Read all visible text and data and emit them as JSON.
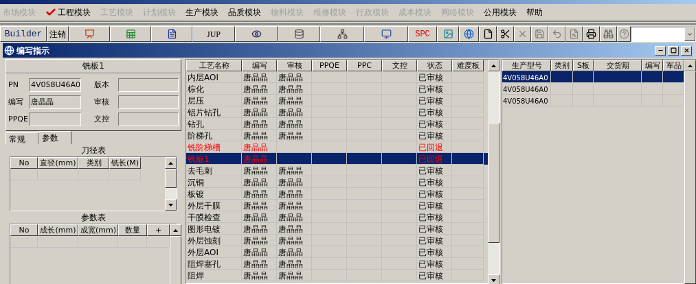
{
  "menu": [
    {
      "label": "市场模块",
      "enabled": false,
      "checked": false
    },
    {
      "label": "工程模块",
      "enabled": true,
      "checked": true
    },
    {
      "label": "工艺模块",
      "enabled": false,
      "checked": false
    },
    {
      "label": "计划模块",
      "enabled": false,
      "checked": false
    },
    {
      "label": "生产模块",
      "enabled": true,
      "checked": false
    },
    {
      "label": "品质模块",
      "enabled": true,
      "checked": false
    },
    {
      "label": "物料模块",
      "enabled": false,
      "checked": false
    },
    {
      "label": "维修模块",
      "enabled": false,
      "checked": false
    },
    {
      "label": "行政模块",
      "enabled": false,
      "checked": false
    },
    {
      "label": "成本模块",
      "enabled": false,
      "checked": false
    },
    {
      "label": "网络模块",
      "enabled": false,
      "checked": false
    },
    {
      "label": "公用模块",
      "enabled": true,
      "checked": false
    },
    {
      "label": "帮助",
      "enabled": true,
      "checked": false
    }
  ],
  "toolbar": {
    "builder": "Builder",
    "logout": "注销",
    "jup": "JUP",
    "spc": "SPC"
  },
  "window": {
    "title": "编写指示"
  },
  "process": {
    "header": "铣板1",
    "fields": [
      {
        "label": "PN",
        "value": "4V058U46A0"
      },
      {
        "label": "版本"
      },
      {
        "label": "编写",
        "value": "唐晶晶"
      },
      {
        "label": "审核"
      },
      {
        "label": "PPQE"
      },
      {
        "label": "文控"
      }
    ]
  },
  "tabs": [
    {
      "label": "常规",
      "selected": false
    },
    {
      "label": "参数",
      "selected": true
    }
  ],
  "tool_table": {
    "title": "刀径表",
    "columns": [
      "No",
      "直径(mm)",
      "类别",
      "铣长(M)"
    ]
  },
  "param_table": {
    "title": "参数表",
    "columns": [
      "No",
      "成长(mm)",
      "成宽(mm)",
      "数量",
      "+"
    ]
  },
  "steps": {
    "columns": [
      "工艺名称",
      "编写",
      "审核",
      "PPQE",
      "PPC",
      "文控",
      "状态",
      "难度板"
    ],
    "rows": [
      {
        "name": "内层AOI",
        "writer": "唐晶晶",
        "reviewer": "唐晶晶",
        "status": "已审核",
        "returned": false,
        "selected": false
      },
      {
        "name": "棕化",
        "writer": "唐晶晶",
        "reviewer": "唐晶晶",
        "status": "已审核",
        "returned": false,
        "selected": false
      },
      {
        "name": "层压",
        "writer": "唐晶晶",
        "reviewer": "唐晶晶",
        "status": "已审核",
        "returned": false,
        "selected": false
      },
      {
        "name": "铝片钻孔",
        "writer": "唐晶晶",
        "reviewer": "唐晶晶",
        "status": "已审核",
        "returned": false,
        "selected": false
      },
      {
        "name": "钻孔",
        "writer": "唐晶晶",
        "reviewer": "唐晶晶",
        "status": "已审核",
        "returned": false,
        "selected": false
      },
      {
        "name": "阶梯孔",
        "writer": "唐晶晶",
        "reviewer": "唐晶晶",
        "status": "已审核",
        "returned": false,
        "selected": false
      },
      {
        "name": "铣阶梯槽",
        "writer": "唐晶晶",
        "status": "已回退",
        "returned": true,
        "selected": false
      },
      {
        "name": "铣板1",
        "writer": "唐晶晶",
        "status": "已回退",
        "returned": true,
        "selected": true
      },
      {
        "name": "去毛刺",
        "writer": "唐晶晶",
        "reviewer": "唐晶晶",
        "status": "已审核",
        "returned": false,
        "selected": false
      },
      {
        "name": "沉铜",
        "writer": "唐晶晶",
        "reviewer": "唐晶晶",
        "status": "已审核",
        "returned": false,
        "selected": false
      },
      {
        "name": "板镀",
        "writer": "唐晶晶",
        "reviewer": "唐晶晶",
        "status": "已审核",
        "returned": false,
        "selected": false
      },
      {
        "name": "外层干膜",
        "writer": "唐晶晶",
        "reviewer": "唐晶晶",
        "status": "已审核",
        "returned": false,
        "selected": false
      },
      {
        "name": "干膜检查",
        "writer": "唐晶晶",
        "reviewer": "唐晶晶",
        "status": "已审核",
        "returned": false,
        "selected": false
      },
      {
        "name": "图形电镀",
        "writer": "唐晶晶",
        "reviewer": "唐晶晶",
        "status": "已审核",
        "returned": false,
        "selected": false
      },
      {
        "name": "外层蚀刻",
        "writer": "唐晶晶",
        "reviewer": "唐晶晶",
        "status": "已审核",
        "returned": false,
        "selected": false
      },
      {
        "name": "外层AOI",
        "writer": "唐晶晶",
        "reviewer": "唐晶晶",
        "status": "已审核",
        "returned": false,
        "selected": false
      },
      {
        "name": "阻焊塞孔",
        "writer": "唐晶晶",
        "reviewer": "唐晶晶",
        "status": "已审核",
        "returned": false,
        "selected": false
      },
      {
        "name": "阻焊",
        "writer": "唐晶晶",
        "reviewer": "唐晶晶",
        "status": "已审核",
        "returned": false,
        "selected": false
      }
    ]
  },
  "models": {
    "columns": [
      "生产型号",
      "类别",
      "S板",
      "交货期",
      "编写",
      "军品"
    ],
    "rows": [
      {
        "model": "4V058U46A0",
        "selected": true
      },
      {
        "model": "4V058U46A0",
        "selected": false
      },
      {
        "model": "4V058U46A0",
        "selected": false
      }
    ]
  }
}
